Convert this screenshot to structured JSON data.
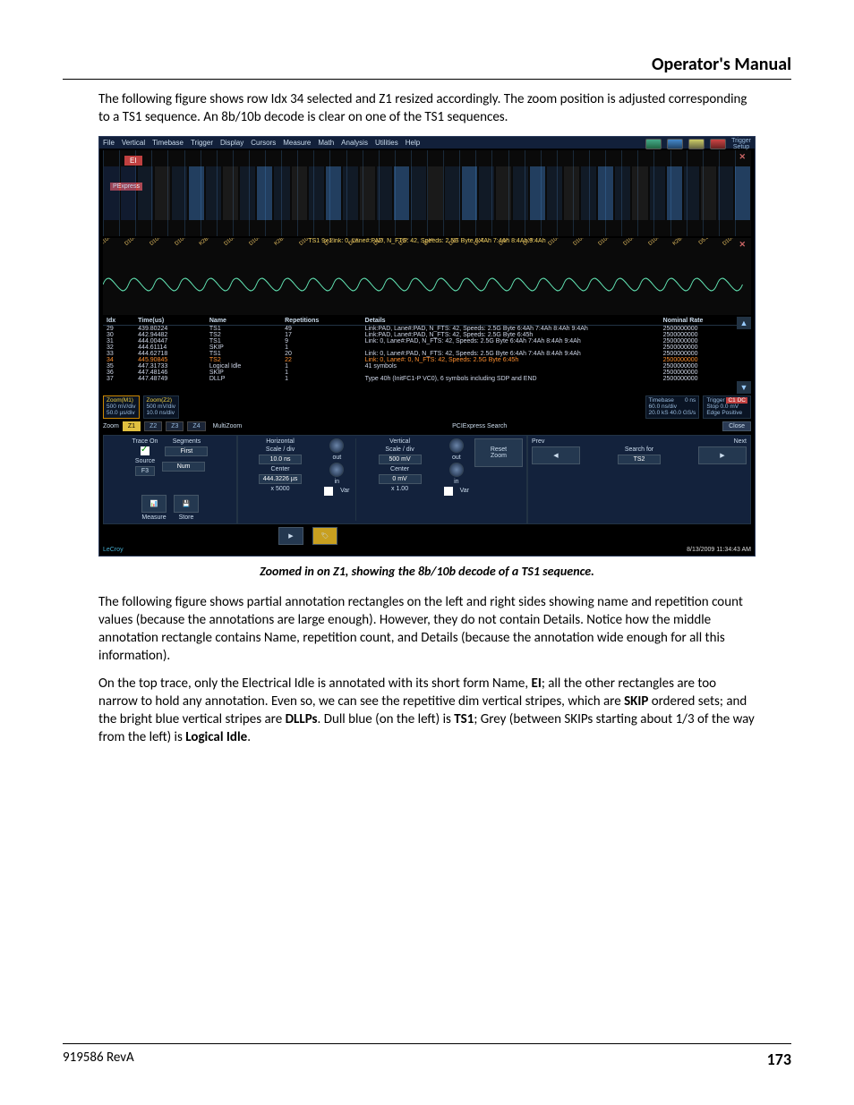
{
  "header": {
    "title": "Operator's Manual"
  },
  "para1": "The following figure shows row Idx 34 selected and Z1 resized accordingly. The zoom position is adjusted corresponding to a TS1 sequence. An 8b/10b decode is clear on one of the TS1 sequences.",
  "caption": "Zoomed in on Z1, showing the 8b/10b decode of a TS1 sequence.",
  "para2": "The following figure shows partial annotation rectangles on the left and right sides showing name and repetition count values (because the annotations are large enough). However, they do not contain Details. Notice how the middle annotation rectangle contains Name, repetition count, and Details (because the annotation wide enough for all this information).",
  "para3_a": "On the top trace, only the Electrical Idle is annotated with its short form Name, ",
  "para3_b": "; all the other rectangles are too narrow to hold any annotation. Even so, we can see the repetitive dim vertical stripes, which are ",
  "para3_c": " ordered sets; and the bright blue vertical stripes are ",
  "para3_d": ". Dull blue (on the left) is ",
  "para3_e": "; Grey (between SKIPs starting about 1/3 of the way from the left) is ",
  "para3_f": ".",
  "bold": {
    "ei": "EI",
    "skip": "SKIP",
    "dllps": "DLLPs",
    "ts1": "TS1",
    "li": "Logical Idle"
  },
  "footer": {
    "left": "919586 RevA",
    "page": "173"
  },
  "scope": {
    "menubar": [
      "File",
      "Vertical",
      "Timebase",
      "Trigger",
      "Display",
      "Cursors",
      "Measure",
      "Math",
      "Analysis",
      "Utilities",
      "Help"
    ],
    "trigger_btn": "Trigger\nSetup",
    "ei_badge": "EI",
    "pex_badge": "PExpress",
    "wave2_label": "TS1 9x Link: 0, Lane#:PAD, N_FTS: 42, Speeds: 2.5G Byte 6:4Ah 7:4Ah 8:4Ah 9:4Ah",
    "table": {
      "headers": [
        "Idx",
        "Time(us)",
        "Name",
        "Repetitions",
        "Details",
        "Nominal Rate"
      ],
      "rows": [
        {
          "idx": "29",
          "time": "439.80224",
          "name": "TS1",
          "rep": "49",
          "det": "Link:PAD, Lane#:PAD, N_FTS: 42, Speeds: 2.5G Byte 6:4Ah 7:4Ah 8:4Ah 9:4Ah",
          "rate": "2500000000"
        },
        {
          "idx": "30",
          "time": "442.94482",
          "name": "TS2",
          "rep": "17",
          "det": "Link:PAD, Lane#:PAD, N_FTS: 42, Speeds: 2.5G Byte 6:45h",
          "rate": "2500000000"
        },
        {
          "idx": "31",
          "time": "444.00447",
          "name": "TS1",
          "rep": "9",
          "det": "Link: 0, Lane#:PAD, N_FTS: 42, Speeds: 2.5G Byte 6:4Ah 7:4Ah 8:4Ah 9:4Ah",
          "rate": "2500000000"
        },
        {
          "idx": "32",
          "time": "444.61114",
          "name": "SKIP",
          "rep": "1",
          "det": "",
          "rate": "2500000000"
        },
        {
          "idx": "33",
          "time": "444.62718",
          "name": "TS1",
          "rep": "20",
          "det": "Link: 0, Lane#:PAD, N_FTS: 42, Speeds: 2.5G Byte 6:4Ah 7:4Ah 8:4Ah 9:4Ah",
          "rate": "2500000000"
        },
        {
          "idx": "34",
          "time": "445.90845",
          "name": "TS2",
          "rep": "22",
          "det": "Link: 0, Lane#: 0, N_FTS: 42, Speeds: 2.5G Byte 6:45h",
          "rate": "2500000000",
          "sel": true
        },
        {
          "idx": "35",
          "time": "447.31733",
          "name": "Logical Idle",
          "rep": "1",
          "det": "41 symbols",
          "rate": "2500000000"
        },
        {
          "idx": "36",
          "time": "447.48146",
          "name": "SKIP",
          "rep": "1",
          "det": "",
          "rate": "2500000000"
        },
        {
          "idx": "37",
          "time": "447.48749",
          "name": "DLLP",
          "rep": "1",
          "det": "Type 40h (InitFC1-P VC0), 6 symbols including SDP and END",
          "rate": "2500000000"
        }
      ]
    },
    "status": {
      "z1": {
        "t": "Zoom(M1)",
        "a": "500 mV/div",
        "b": "50.0 µs/div"
      },
      "z2": {
        "t": "Zoom(Z2)",
        "a": "500 mV/div",
        "b": "10.0 ns/div"
      },
      "tb": {
        "t": "Timebase",
        "a": "60.0 ns/div",
        "b": "20.0 kS   40.0 GS/s",
        "c": "0 ns"
      },
      "tr": {
        "t": "Trigger",
        "a": "Stop",
        "b": "Edge",
        "c": "0.0 mV",
        "d": "Positive",
        "e": "C1 DC"
      }
    },
    "zoomrow": {
      "label": "Zoom",
      "tabs": [
        "Z1",
        "Z2",
        "Z3",
        "Z4"
      ],
      "multi": "MultiZoom",
      "search": "PCIExpress Search",
      "close": "Close"
    },
    "ctl": {
      "left": {
        "trace_on": "Trace On",
        "source": "Source",
        "src_val": "F3",
        "segments": "Segments",
        "first": "First",
        "num": "Num"
      },
      "mid": {
        "h": {
          "title": "Horizontal",
          "scale": "Scale / div",
          "scale_v": "10.0 ns",
          "center": "Center",
          "center_v": "444.3226 µs",
          "factor": "x 5000",
          "out": "out",
          "in": "in",
          "var": "Var"
        },
        "v": {
          "title": "Vertical",
          "scale": "Scale / div",
          "scale_v": "500 mV",
          "center": "Center",
          "center_v": "0 mV",
          "factor": "x 1.00",
          "out": "out",
          "in": "in",
          "var": "Var"
        },
        "reset": "Reset\nZoom",
        "bottom": {
          "measure": "Measure",
          "store": "Store",
          "next": "Next",
          "label": "Label"
        }
      },
      "right": {
        "prev": "Prev",
        "next": "Next",
        "search_for": "Search for",
        "val": "TS2"
      }
    },
    "bottom": {
      "brand": "LeCroy",
      "ts": "8/13/2009 11:34:43 AM"
    }
  }
}
